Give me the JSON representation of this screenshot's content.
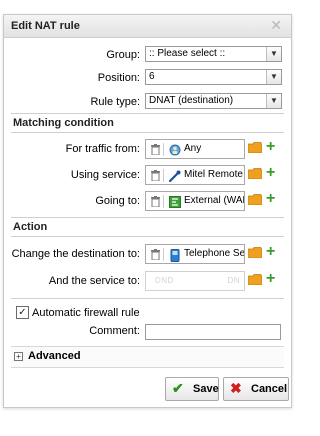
{
  "dialog": {
    "title": "Edit NAT rule"
  },
  "form": {
    "group": {
      "label": "Group:",
      "value": ":: Please select ::"
    },
    "position": {
      "label": "Position:",
      "value": "6"
    },
    "rule_type": {
      "label": "Rule type:",
      "value": "DNAT (destination)"
    }
  },
  "matching": {
    "heading": "Matching condition",
    "traffic_from": {
      "label": "For traffic from:",
      "value": "Any"
    },
    "using_service": {
      "label": "Using service:",
      "value": "Mitel Remote"
    },
    "going_to": {
      "label": "Going to:",
      "value": "External (WAN)"
    }
  },
  "action": {
    "heading": "Action",
    "change_destination": {
      "label": "Change the destination to:",
      "value": "Telephone Se"
    },
    "service_to": {
      "label": "And the service to:",
      "placeholder_left": "DND",
      "placeholder_right": "DN"
    }
  },
  "auto_firewall": {
    "label": "Automatic firewall rule",
    "checked": true
  },
  "comment": {
    "label": "Comment:",
    "value": ""
  },
  "advanced": {
    "label": "Advanced"
  },
  "buttons": {
    "save": "Save",
    "cancel": "Cancel"
  },
  "colors": {
    "add_green": "#3a9a2a",
    "folder_orange": "#f0a020",
    "cancel_red": "#cc2020",
    "save_green": "#2f8f1f"
  }
}
